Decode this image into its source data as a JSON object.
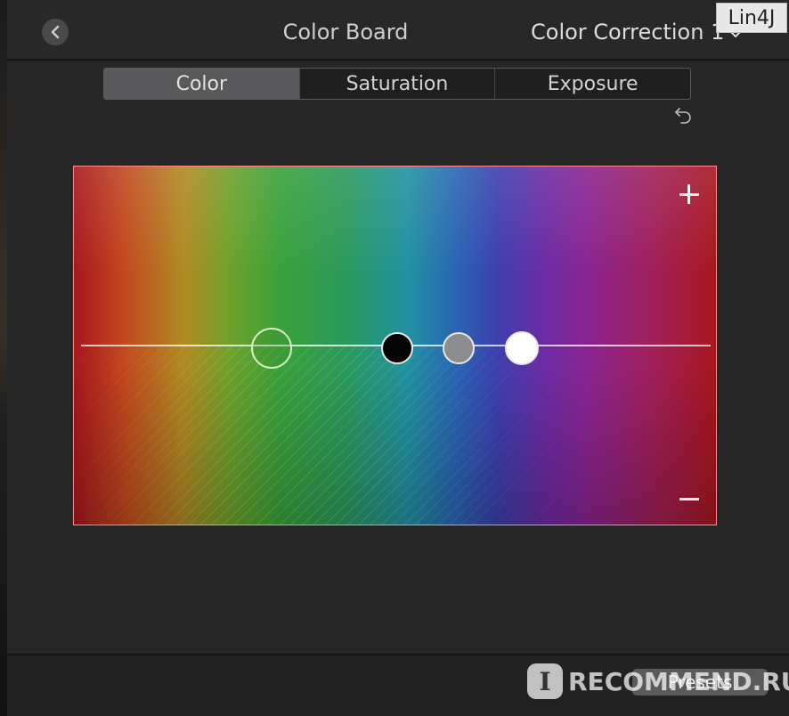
{
  "header": {
    "title": "Color Board",
    "correction_label": "Color Correction 1"
  },
  "tabs": [
    {
      "label": "Color",
      "active": true
    },
    {
      "label": "Saturation",
      "active": false
    },
    {
      "label": "Exposure",
      "active": false
    }
  ],
  "board": {
    "hue_gradient_colors": [
      "#a8161e",
      "#c2491e",
      "#b08a22",
      "#70a12a",
      "#3aa13a",
      "#2b9a5a",
      "#2191a2",
      "#2a62b4",
      "#3d3fae",
      "#6a2ca4",
      "#8a2491",
      "#a01f5a",
      "#a8161e"
    ],
    "pucks": [
      {
        "name": "global",
        "color": "#3c8c28"
      },
      {
        "name": "shadows",
        "color": "#050505"
      },
      {
        "name": "midtones",
        "color": "#8d8d8f"
      },
      {
        "name": "highlights",
        "color": "#ffffff"
      }
    ]
  },
  "footer": {
    "presets_label": "Presets"
  },
  "watermarks": {
    "top_right": "Lin4J",
    "bottom_badge": "I",
    "bottom_text": "RECOMMEND.RU"
  },
  "icons": {
    "back": "chevron-left-icon",
    "dropdown": "chevron-down-icon",
    "undo": "undo-icon",
    "add": "plus-icon",
    "subtract": "minus-icon"
  }
}
